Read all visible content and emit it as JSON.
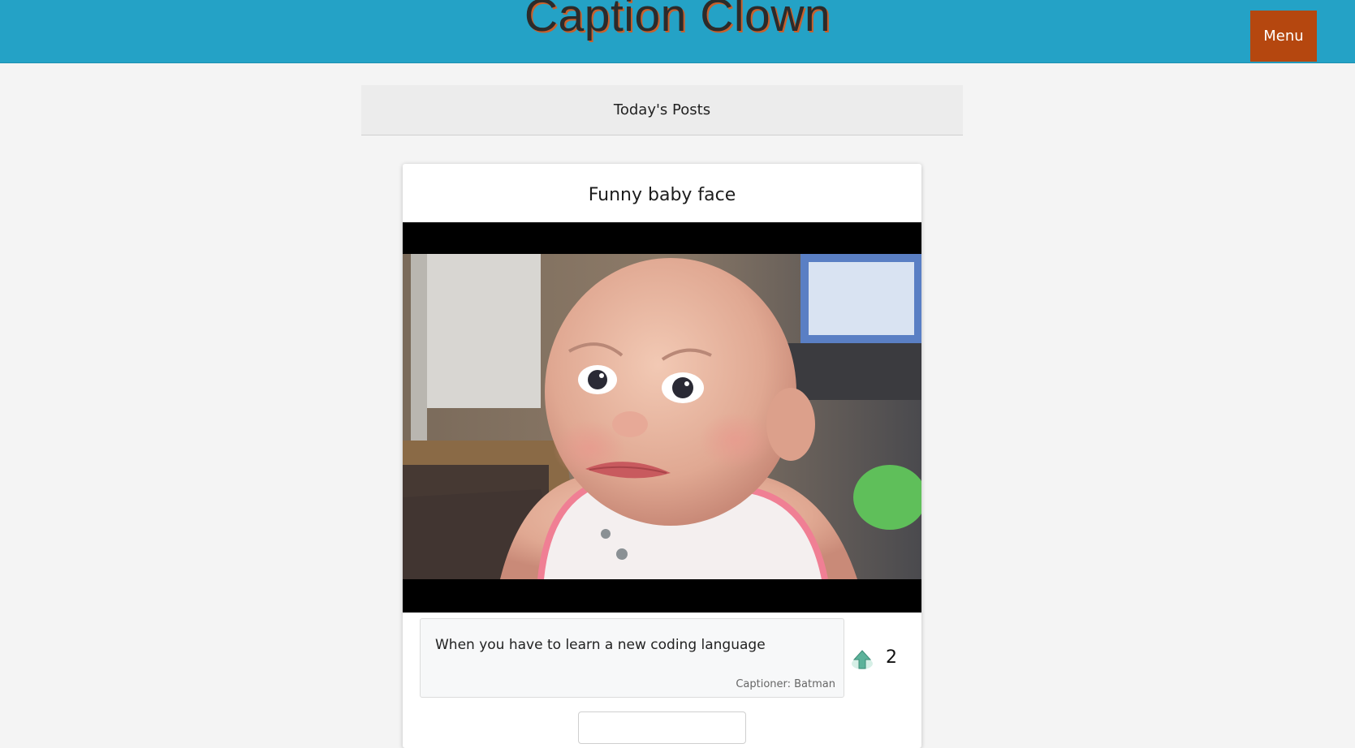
{
  "header": {
    "site_title": "Caption Clown",
    "menu_label": "Menu",
    "bg_color": "#24a2c6",
    "menu_color": "#b5470f"
  },
  "posts_bar": {
    "label": "Today's Posts"
  },
  "post": {
    "title": "Funny baby face",
    "media_icon": "baby-video-still",
    "caption": {
      "text": "When you have to learn a new coding language",
      "captioner": "Captioner: Batman"
    },
    "votes": {
      "icon": "upvote-icon",
      "count": "2"
    }
  }
}
